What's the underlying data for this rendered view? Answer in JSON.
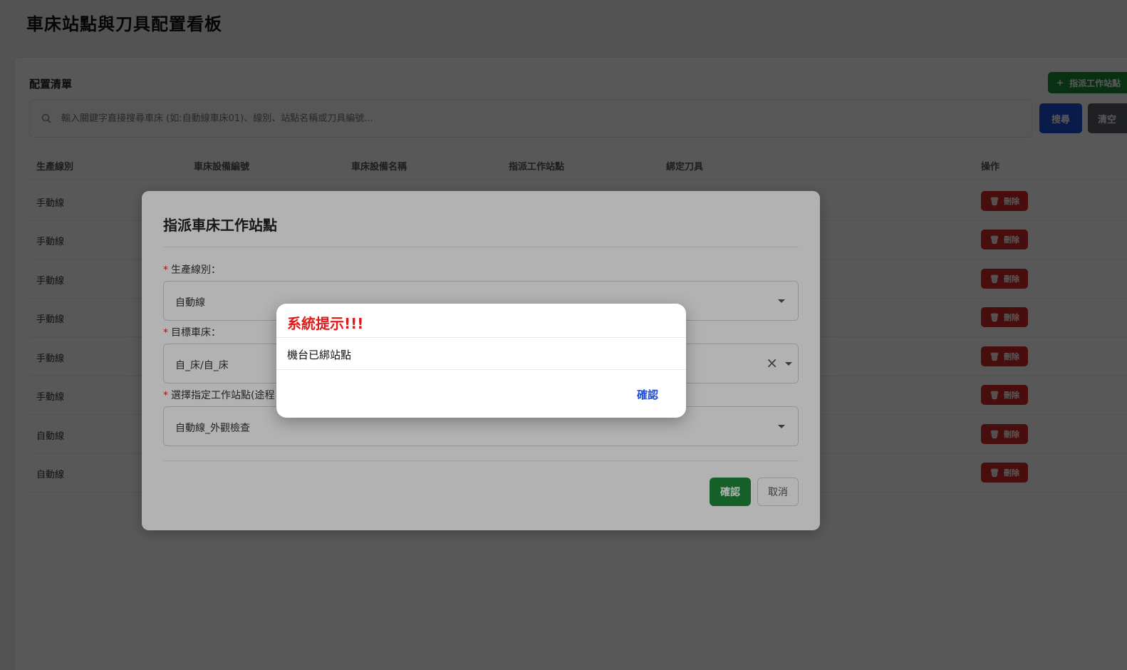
{
  "page": {
    "title": "車床站點與刀具配置看板"
  },
  "card": {
    "title": "配置清單",
    "add_button_label": "指派工作站點",
    "search_placeholder": "輸入關鍵字直接搜尋車床 (如:自動線車床01)、線別、站點名稱或刀具編號...",
    "search_button_label": "搜尋",
    "clear_button_label": "清空"
  },
  "table": {
    "columns": [
      "生產線別",
      "車床設備編號",
      "車床設備名稱",
      "指派工作站點",
      "綁定刀具",
      "操作"
    ],
    "rows": [
      {
        "line": "手動線",
        "action": "刪除"
      },
      {
        "line": "手動線",
        "action": "刪除"
      },
      {
        "line": "手動線",
        "action": "刪除"
      },
      {
        "line": "手動線",
        "action": "刪除"
      },
      {
        "line": "手動線",
        "action": "刪除"
      },
      {
        "line": "手動線",
        "action": "刪除"
      },
      {
        "line": "自動線",
        "action": "刪除"
      },
      {
        "line": "自動線",
        "action": "刪除"
      }
    ]
  },
  "modal": {
    "title": "指派車床工作站點",
    "fields": [
      {
        "label": "生產線別：",
        "value": "自動線"
      },
      {
        "label": "目標車床：",
        "value": "自_床/自_床"
      },
      {
        "label": "選擇指定工作站點(途程",
        "value": "自動線_外觀檢查"
      }
    ],
    "confirm_label": "確認",
    "cancel_label": "取消"
  },
  "alert": {
    "title": "系統提示!!!",
    "message": "機台已綁站點",
    "ok_label": "確認"
  },
  "colors": {
    "primary_green": "#1e8a3a",
    "primary_blue": "#1d4fd8",
    "danger_red": "#d12b2b",
    "alert_title_red": "#e01b1b"
  }
}
